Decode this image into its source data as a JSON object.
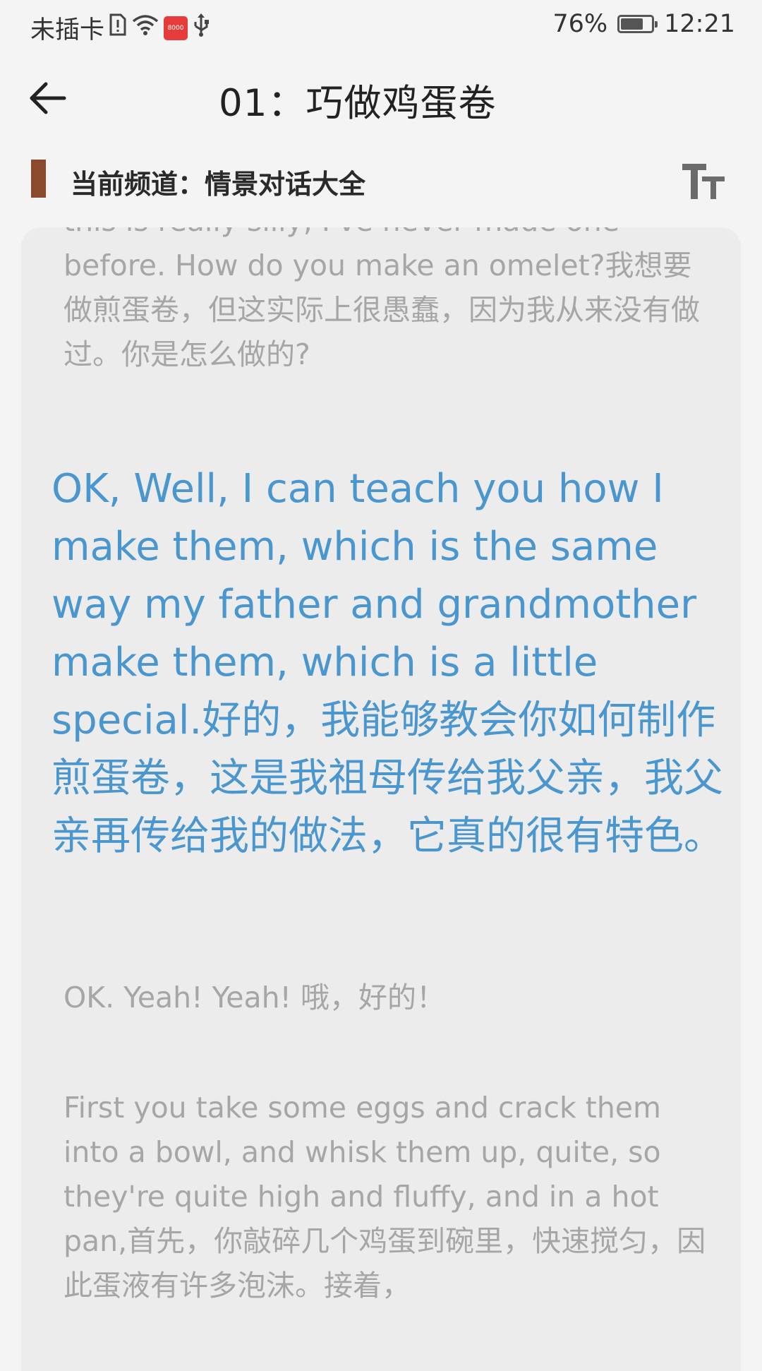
{
  "status_bar": {
    "carrier": "未插卡",
    "app_badge": "8000",
    "battery_percent": "76%",
    "battery_level": 0.76,
    "time": "12:21",
    "icons": [
      "sim-alert-icon",
      "wifi-icon",
      "app-notification-icon",
      "usb-icon",
      "battery-charging-icon"
    ]
  },
  "header": {
    "title": "01：巧做鸡蛋卷",
    "back_icon": "arrow-left-icon"
  },
  "channel": {
    "label": "当前频道：情景对话大全",
    "marker_color": "#8b4a2b",
    "font_size_icon": "text-size-icon"
  },
  "colors": {
    "active_text": "#4a96cf",
    "inactive_text": "#a6a6a6",
    "card_bg": "#ececec"
  },
  "dialog": [
    {
      "text": "this is really silly, I've never made one before. How do you make an omelet?我想要做煎蛋卷，但这实际上很愚蠢，因为我从来没有做过。你是怎么做的?",
      "active": false
    },
    {
      "text": "OK, Well, I can teach you how I make them, which is the same way my father and grandmother make them, which is a little special.好的，我能够教会你如何制作煎蛋卷，这是我祖母传给我父亲，我父亲再传给我的做法，它真的很有特色。",
      "active": true
    },
    {
      "text": "OK. Yeah! Yeah! 哦，好的！",
      "active": false
    },
    {
      "text": "First you take some eggs and crack them into a bowl, and whisk them up, quite, so they're quite high and fluffy, and in a hot pan,首先，你敲碎几个鸡蛋到碗里，快速搅匀，因此蛋液有许多泡沫。接着，",
      "active": false
    }
  ]
}
